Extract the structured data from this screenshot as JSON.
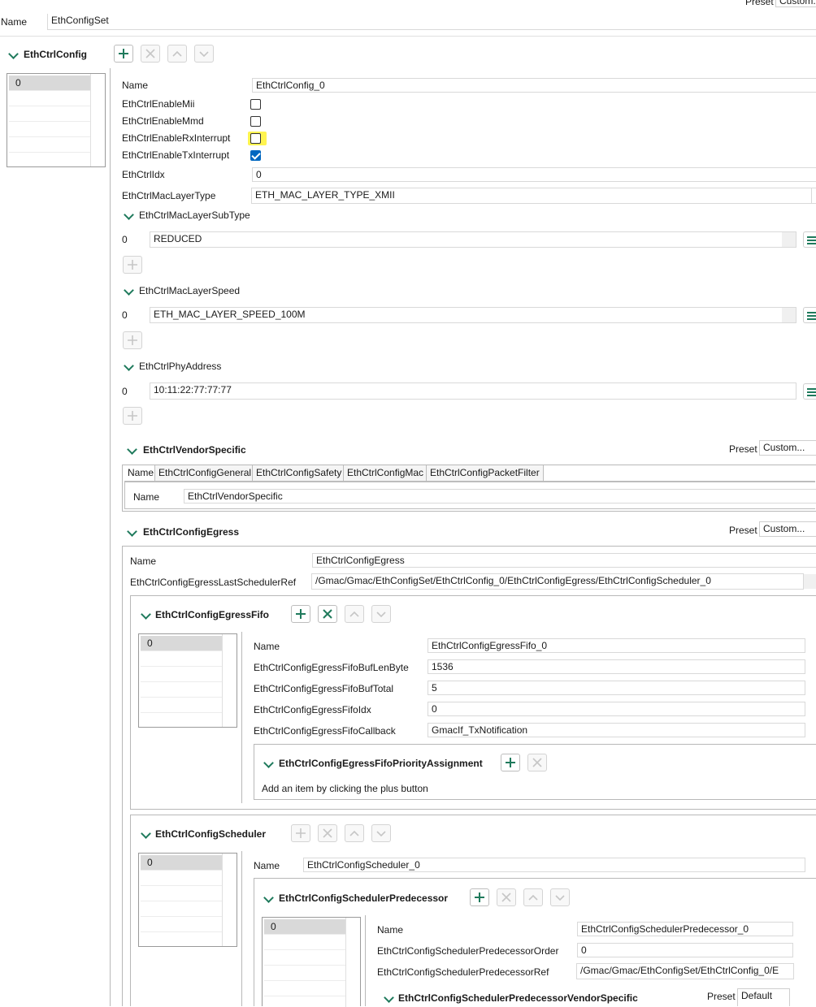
{
  "top": {
    "preset_label": "Preset",
    "preset_value": "Custom...",
    "name_label": "Name",
    "name_value": "EthConfigSet"
  },
  "ethctrlconfig": {
    "title": "EthCtrlConfig",
    "list_items": [
      "0"
    ],
    "fields": {
      "name_label": "Name",
      "name_value": "EthCtrlConfig_0",
      "enable_mii_label": "EthCtrlEnableMii",
      "enable_mmd_label": "EthCtrlEnableMmd",
      "enable_rx_interrupt_label": "EthCtrlEnableRxInterrupt",
      "enable_tx_interrupt_label": "EthCtrlEnableTxInterrupt",
      "idx_label": "EthCtrlIdx",
      "idx_value": "0",
      "mac_layer_type_label": "EthCtrlMacLayerType",
      "mac_layer_type_value": "ETH_MAC_LAYER_TYPE_XMII"
    },
    "checkboxes": {
      "enable_mii": false,
      "enable_mmd": false,
      "enable_rx_interrupt": false,
      "enable_tx_interrupt": true
    },
    "mac_layer_subtype": {
      "title": "EthCtrlMacLayerSubType",
      "index": "0",
      "value": "REDUCED"
    },
    "mac_layer_speed": {
      "title": "EthCtrlMacLayerSpeed",
      "index": "0",
      "value": "ETH_MAC_LAYER_SPEED_100M"
    },
    "phy_address": {
      "title": "EthCtrlPhyAddress",
      "index": "0",
      "value": "10:11:22:77:77:77"
    }
  },
  "vendor_specific": {
    "title": "EthCtrlVendorSpecific",
    "preset_label": "Preset",
    "preset_value": "Custom...",
    "tabs": [
      "Name",
      "EthCtrlConfigGeneral",
      "EthCtrlConfigSafety",
      "EthCtrlConfigMac",
      "EthCtrlConfigPacketFilter"
    ],
    "name_label": "Name",
    "name_value": "EthCtrlVendorSpecific"
  },
  "egress": {
    "title": "EthCtrlConfigEgress",
    "preset_label": "Preset",
    "preset_value": "Custom...",
    "name_label": "Name",
    "name_value": "EthCtrlConfigEgress",
    "last_scheduler_ref_label": "EthCtrlConfigEgressLastSchedulerRef",
    "last_scheduler_ref_value": "/Gmac/Gmac/EthConfigSet/EthCtrlConfig_0/EthCtrlConfigEgress/EthCtrlConfigScheduler_0"
  },
  "fifo": {
    "title": "EthCtrlConfigEgressFifo",
    "list_items": [
      "0"
    ],
    "name_label": "Name",
    "name_value": "EthCtrlConfigEgressFifo_0",
    "buf_len_label": "EthCtrlConfigEgressFifoBufLenByte",
    "buf_len_value": "1536",
    "buf_total_label": "EthCtrlConfigEgressFifoBufTotal",
    "buf_total_value": "5",
    "idx_label": "EthCtrlConfigEgressFifoIdx",
    "idx_value": "0",
    "callback_label": "EthCtrlConfigEgressFifoCallback",
    "callback_value": "GmacIf_TxNotification",
    "priority": {
      "title": "EthCtrlConfigEgressFifoPriorityAssignment",
      "empty_hint": "Add an item by clicking the plus button"
    }
  },
  "scheduler": {
    "title": "EthCtrlConfigScheduler",
    "list_items": [
      "0"
    ],
    "name_label": "Name",
    "name_value": "EthCtrlConfigScheduler_0",
    "predecessor": {
      "title": "EthCtrlConfigSchedulerPredecessor",
      "list_items": [
        "0"
      ],
      "name_label": "Name",
      "name_value": "EthCtrlConfigSchedulerPredecessor_0",
      "order_label": "EthCtrlConfigSchedulerPredecessorOrder",
      "order_value": "0",
      "ref_label": "EthCtrlConfigSchedulerPredecessorRef",
      "ref_value": "/Gmac/Gmac/EthConfigSet/EthCtrlConfig_0/E",
      "vendor_specific_title": "EthCtrlConfigSchedulerPredecessorVendorSpecific",
      "preset_label": "Preset",
      "preset_value": "Default"
    }
  },
  "colors": {
    "accent": "#1f7a5c",
    "checkbox_checked": "#0067c0",
    "highlight": "#fff44f",
    "selection": "#d9d9d9"
  }
}
